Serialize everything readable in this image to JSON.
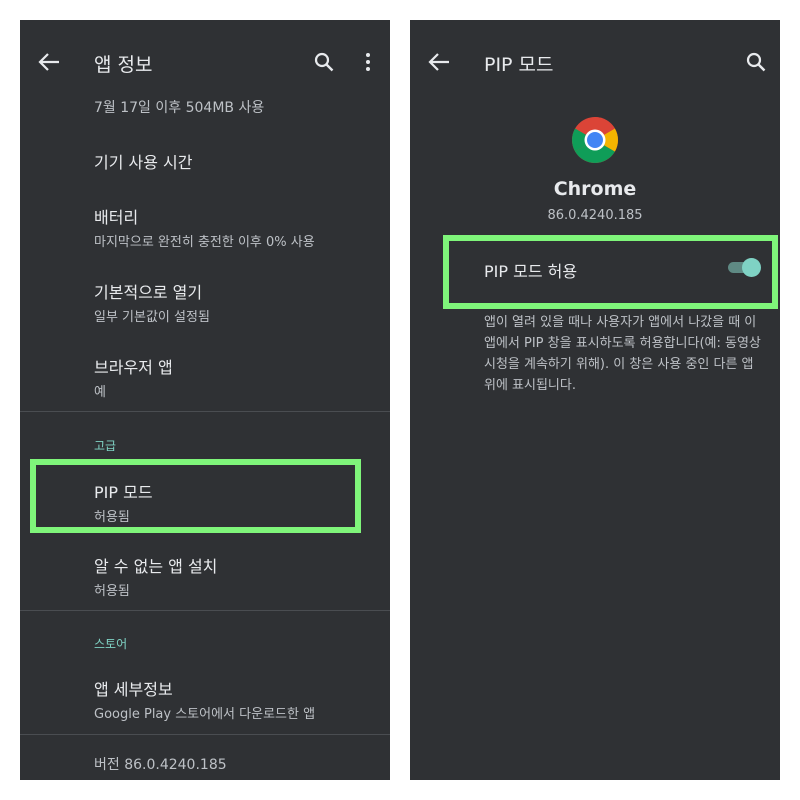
{
  "left_screen": {
    "title": "앱 정보",
    "partial_top": "7월 17일 이후 504MB 사용",
    "items": [
      {
        "title": "기기 사용 시간",
        "subtitle": ""
      },
      {
        "title": "배터리",
        "subtitle": "마지막으로 완전히 충전한 이후 0% 사용"
      },
      {
        "title": "기본적으로 열기",
        "subtitle": "일부 기본값이 설정됨"
      },
      {
        "title": "브라우저 앱",
        "subtitle": "예"
      }
    ],
    "section_advanced": "고급",
    "advanced_items": [
      {
        "title": "PIP 모드",
        "subtitle": "허용됨"
      },
      {
        "title": "알 수 없는 앱 설치",
        "subtitle": "허용됨"
      }
    ],
    "section_store": "스토어",
    "store_items": [
      {
        "title": "앱 세부정보",
        "subtitle": "Google Play 스토어에서 다운로드한 앱"
      }
    ],
    "version": "버전 86.0.4240.185"
  },
  "right_screen": {
    "title": "PIP 모드",
    "app_name": "Chrome",
    "app_version": "86.0.4240.185",
    "pip_toggle_label": "PIP 모드 허용",
    "pip_toggle_on": true,
    "description": "앱이 열려 있을 때나 사용자가 앱에서 나갔을 때 이 앱에서 PIP 창을 표시하도록 허용합니다(예: 동영상 시청을 계속하기 위해). 이 창은 사용 중인 다른 앱 위에 표시됩니다."
  },
  "colors": {
    "background": "#2f3134",
    "accent": "#7fd2c4",
    "highlight": "#7ff57a"
  },
  "icons": [
    "back-arrow-icon",
    "search-icon",
    "more-vert-icon",
    "chrome-icon"
  ]
}
